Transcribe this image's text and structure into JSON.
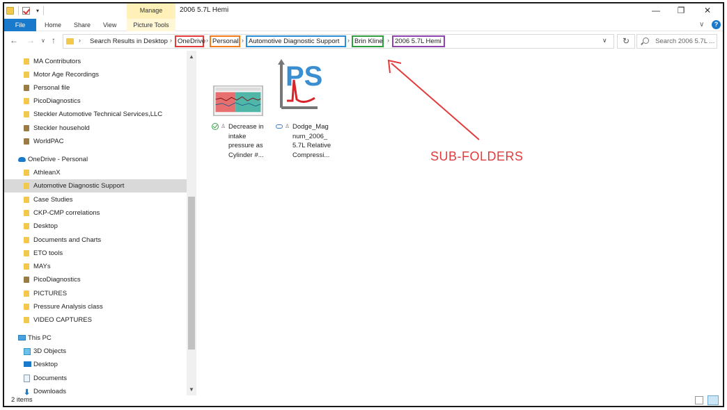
{
  "window": {
    "title": "2006 5.7L Hemi",
    "manage_tab": "Manage",
    "min_glyph": "—",
    "max_glyph": "❐",
    "close_glyph": "✕"
  },
  "ribbon": {
    "tabs": [
      "File",
      "Home",
      "Share",
      "View",
      "Picture Tools"
    ],
    "chevron": "∨",
    "help": "?"
  },
  "nav": {
    "back": "←",
    "forward": "→",
    "recent": "∨",
    "up": "↑",
    "refresh": "↻",
    "dropdown": "∨"
  },
  "address": {
    "separator": "›",
    "crumbs": [
      {
        "label": "Search Results in Desktop",
        "highlight": ""
      },
      {
        "label": "OneDrive",
        "highlight": "#e23b3b"
      },
      {
        "label": "Personal",
        "highlight": "#f07c1e"
      },
      {
        "label": "Automotive Diagnostic Support",
        "highlight": "#2a8fd6"
      },
      {
        "label": "Brin Kline",
        "highlight": "#2e9e3f"
      },
      {
        "label": "2006 5.7L Hemi",
        "highlight": "#8e44ad"
      }
    ]
  },
  "search": {
    "placeholder": "Search 2006 5.7L ..."
  },
  "navpane": {
    "items": [
      {
        "label": "MA Contributors",
        "icon": "folder-icon"
      },
      {
        "label": "Motor Age Recordings",
        "icon": "folder-icon"
      },
      {
        "label": "Personal file",
        "icon": "shared-folder-icon"
      },
      {
        "label": "PicoDiagnostics",
        "icon": "folder-icon"
      },
      {
        "label": "Steckler Automotive Technical Services,LLC",
        "icon": "folder-icon"
      },
      {
        "label": "Steckler household",
        "icon": "shared-folder-icon"
      },
      {
        "label": "WorldPAC",
        "icon": "shared-folder-icon"
      },
      {
        "label": "OneDrive - Personal",
        "icon": "cloud-icon"
      },
      {
        "label": "AthleanX",
        "icon": "folder-icon"
      },
      {
        "label": "Automotive Diagnostic Support",
        "icon": "folder-icon"
      },
      {
        "label": "Case Studies",
        "icon": "folder-icon"
      },
      {
        "label": "CKP-CMP correlations",
        "icon": "folder-icon"
      },
      {
        "label": "Desktop",
        "icon": "folder-icon"
      },
      {
        "label": "Documents and Charts",
        "icon": "folder-icon"
      },
      {
        "label": "ETO tools",
        "icon": "folder-icon"
      },
      {
        "label": "MAYs",
        "icon": "folder-icon"
      },
      {
        "label": "PicoDiagnostics",
        "icon": "shared-folder-icon"
      },
      {
        "label": "PICTURES",
        "icon": "folder-icon"
      },
      {
        "label": "Pressure Analysis class",
        "icon": "folder-icon"
      },
      {
        "label": "VIDEO CAPTURES",
        "icon": "folder-icon"
      },
      {
        "label": "This PC",
        "icon": "pc-icon"
      },
      {
        "label": "3D Objects",
        "icon": "cube-icon"
      },
      {
        "label": "Desktop",
        "icon": "desktop-icon"
      },
      {
        "label": "Documents",
        "icon": "document-icon"
      },
      {
        "label": "Downloads",
        "icon": "download-icon"
      }
    ],
    "selected_index": 9
  },
  "files": [
    {
      "name": "Decrease in intake pressure as Cylinder #...",
      "status": "synced-check-icon",
      "thumb": "waveform-thumbnail"
    },
    {
      "name": "Dodge_Magnum_2006_5.7L Relative Compressi...",
      "status": "cloud-only-icon",
      "thumb": "picoscope-logo-icon"
    }
  ],
  "file_name_lines": [
    [
      "Decrease in",
      "intake",
      "pressure as",
      "Cylinder #..."
    ],
    [
      "Dodge_Mag",
      "num_2006_",
      "5.7L Relative",
      "Compressi..."
    ]
  ],
  "statusbar": {
    "item_count": "2 items"
  },
  "annotation": {
    "label": "SUB-FOLDERS",
    "color": "#e23b3b"
  },
  "colors": {
    "file_tab": "#1979ca",
    "manage_tab": "#fff1b8",
    "selected_nav": "#d9d9d9",
    "folder": "#f2c94c"
  }
}
